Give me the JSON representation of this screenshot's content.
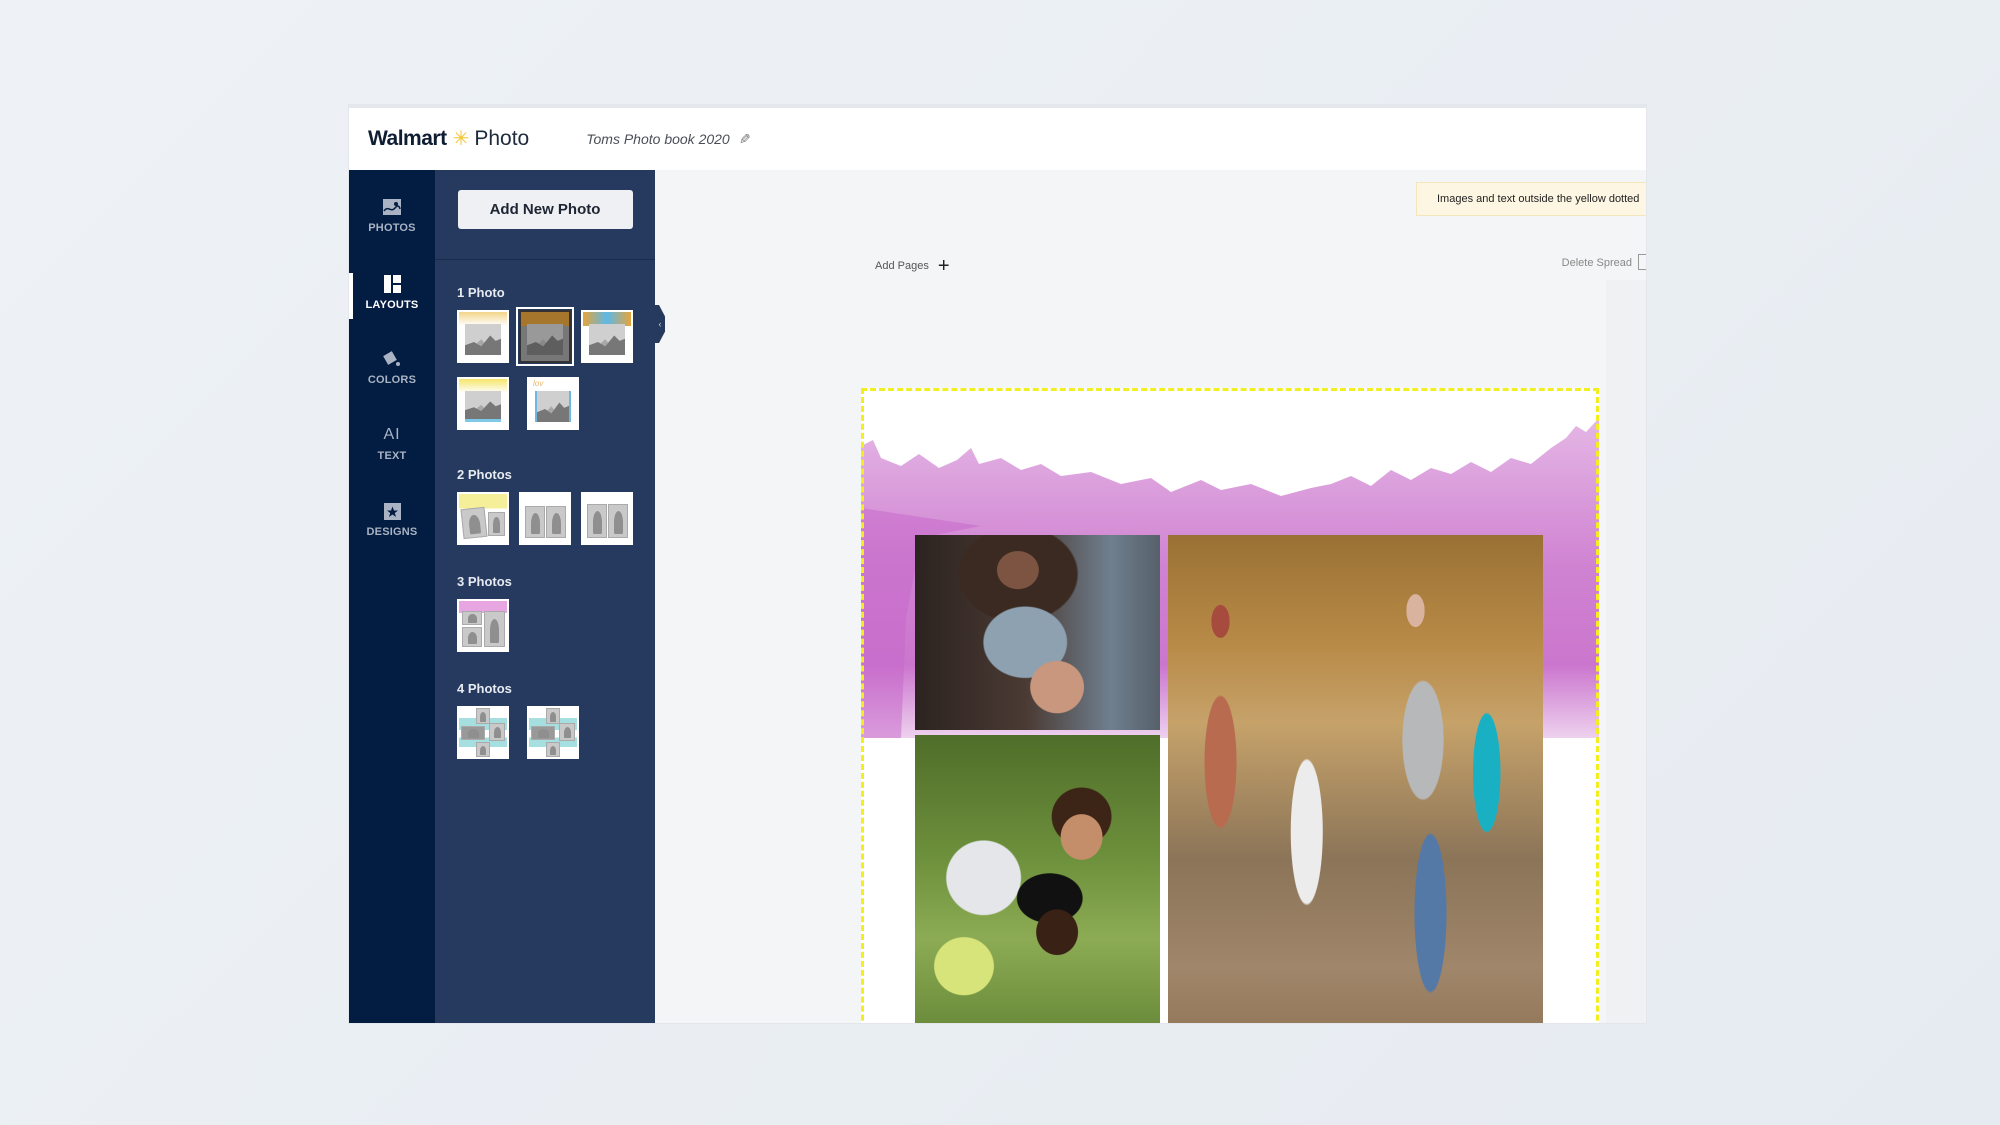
{
  "header": {
    "brand_name": "Walmart",
    "brand_product": "Photo",
    "spark_icon": "✳",
    "project_title": "Toms Photo book 2020",
    "edit_icon": "✎"
  },
  "rail": {
    "items": [
      {
        "label": "PHOTOS",
        "icon": "photos-icon",
        "active": false
      },
      {
        "label": "LAYOUTS",
        "icon": "layouts-icon",
        "active": true
      },
      {
        "label": "COLORS",
        "icon": "paint-bucket-icon",
        "active": false
      },
      {
        "label": "TEXT",
        "icon": "text-icon",
        "active": false
      },
      {
        "label": "DESIGNS",
        "icon": "star-box-icon",
        "active": false
      }
    ],
    "text_glyph": "AI"
  },
  "panel": {
    "add_button": "Add New Photo",
    "collapse_icon": "‹",
    "sections": [
      {
        "title": "1 Photo",
        "count": 5,
        "selected_index": 1
      },
      {
        "title": "2 Photos",
        "count": 3
      },
      {
        "title": "3 Photos",
        "count": 1
      },
      {
        "title": "4 Photos",
        "count": 2
      }
    ]
  },
  "canvas": {
    "notice": "Images and text outside the yellow dotted",
    "add_pages": "Add Pages",
    "add_icon": "+",
    "delete_spread": "Delete Spread",
    "page_photos": [
      {
        "name": "mother-with-newborn"
      },
      {
        "name": "two-children-on-grass"
      },
      {
        "name": "family-walking-in-autumn-park"
      }
    ]
  },
  "colors": {
    "rail_bg": "#021c42",
    "panel_bg": "#253a5e",
    "safe_zone": "#f2ee1f",
    "watercolor": "#c66cc9",
    "brand_spark": "#f6c42d"
  }
}
